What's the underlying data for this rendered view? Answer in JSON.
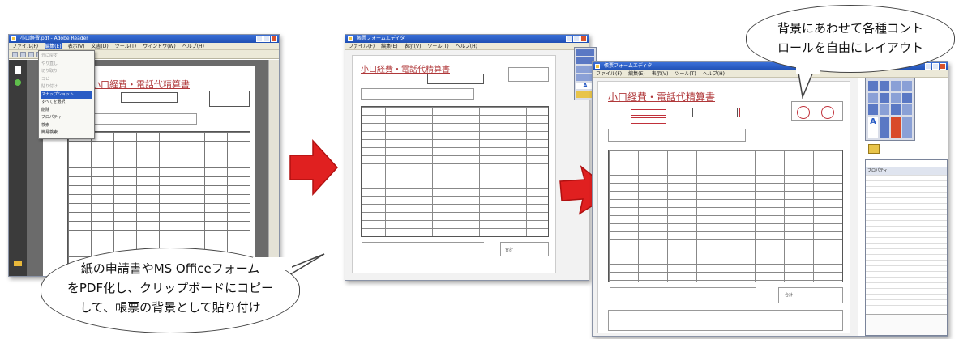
{
  "screens": {
    "left": {
      "window_title": "小口経費.pdf - Adobe Reader",
      "menu_items": [
        "ファイル(F)",
        "編集(E)",
        "表示(V)",
        "文書(D)",
        "ツール(T)",
        "ウィンドウ(W)",
        "ヘルプ(H)"
      ],
      "context_menu_items": [
        "元に戻す",
        "やり直し",
        "切り取り",
        "コピー",
        "貼り付け",
        "削除",
        "すべてを選択",
        "スナップショット",
        "プロパティ",
        "検索",
        "簡易検索"
      ],
      "form_title": "小口経費・電話代精算書"
    },
    "middle": {
      "window_title": "帳票フォームエディタ",
      "menu_items": [
        "ファイル(F)",
        "編集(E)",
        "表示(V)",
        "ツール(T)",
        "ヘルプ(H)"
      ],
      "form_title": "小口経費・電話代精算書",
      "totals_label": "合計"
    },
    "right": {
      "window_title": "帳票フォームエディタ",
      "menu_items": [
        "ファイル(F)",
        "編集(E)",
        "表示(V)",
        "ツール(T)",
        "ヘルプ(H)"
      ],
      "form_title": "小口経費・電話代精算書",
      "totals_label": "合計",
      "properties_title": "プロパティ"
    }
  },
  "callouts": {
    "bottom_left": [
      "紙の申請書やMS Officeフォーム",
      "をPDF化し、クリップボードにコピー",
      "して、帳票の背景として貼り付け"
    ],
    "top_right": [
      "背景にあわせて各種コント",
      "ロールを自由にレイアウト"
    ]
  },
  "colors": {
    "arrow": "#e02020",
    "titlebar": "#2a5cc4",
    "form_title": "#b0383a"
  }
}
